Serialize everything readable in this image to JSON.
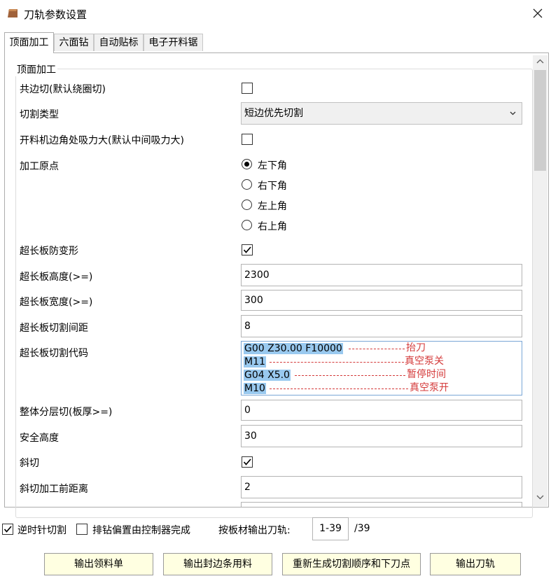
{
  "window": {
    "title": "刀轨参数设置"
  },
  "tabs": [
    {
      "label": "顶面加工"
    },
    {
      "label": "六面钻"
    },
    {
      "label": "自动贴标"
    },
    {
      "label": "电子开料锯"
    }
  ],
  "group": {
    "title": "顶面加工"
  },
  "fields": {
    "shared_edge_cut": {
      "label": "共边切(默认绕圈切)",
      "checked": false
    },
    "cut_type": {
      "label": "切割类型",
      "value": "短边优先切割"
    },
    "corner_suction": {
      "label": "开料机边角处吸力大(默认中间吸力大)",
      "checked": false
    },
    "origin": {
      "label": "加工原点",
      "options": [
        "左下角",
        "右下角",
        "左上角",
        "右上角"
      ],
      "selected": "左下角"
    },
    "long_board_anti_deform": {
      "label": "超长板防变形",
      "checked": true
    },
    "long_board_height": {
      "label": "超长板高度(>=)",
      "value": "2300"
    },
    "long_board_width": {
      "label": "超长板宽度(>=)",
      "value": "300"
    },
    "long_board_spacing": {
      "label": "超长板切割间距",
      "value": "8"
    },
    "long_board_code": {
      "label": "超长板切割代码",
      "lines": [
        {
          "code": "G00 Z30.00 F10000",
          "note": "抬刀"
        },
        {
          "code": "M11",
          "note": "真空泵关"
        },
        {
          "code": "G04 X5.0",
          "note": "暂停时间"
        },
        {
          "code": "M10",
          "note": "真空泵开"
        }
      ]
    },
    "layer_cut": {
      "label": "整体分层切(板厚>=)",
      "value": "0"
    },
    "safe_height": {
      "label": "安全高度",
      "value": "30"
    },
    "bevel_cut": {
      "label": "斜切",
      "checked": true
    },
    "bevel_distance": {
      "label": "斜切加工前距离",
      "value": "2"
    }
  },
  "bottom": {
    "ccw_cut": {
      "label": "逆时针切割",
      "checked": true
    },
    "drill_offset": {
      "label": "排钻偏置由控制器完成",
      "checked": false
    },
    "per_board_label": "按板材输出刀轨:",
    "page_range": "1-39",
    "page_total": "/39"
  },
  "buttons": {
    "output_pick_list": "输出领料单",
    "output_edge_band": "输出封边条用料",
    "regenerate": "重新生成切割顺序和下刀点",
    "output_toolpath": "输出刀轨"
  },
  "colors": {
    "note_red": "#d43a3a",
    "highlight": "#99c9ef",
    "button_bg": "#ffffe1"
  }
}
